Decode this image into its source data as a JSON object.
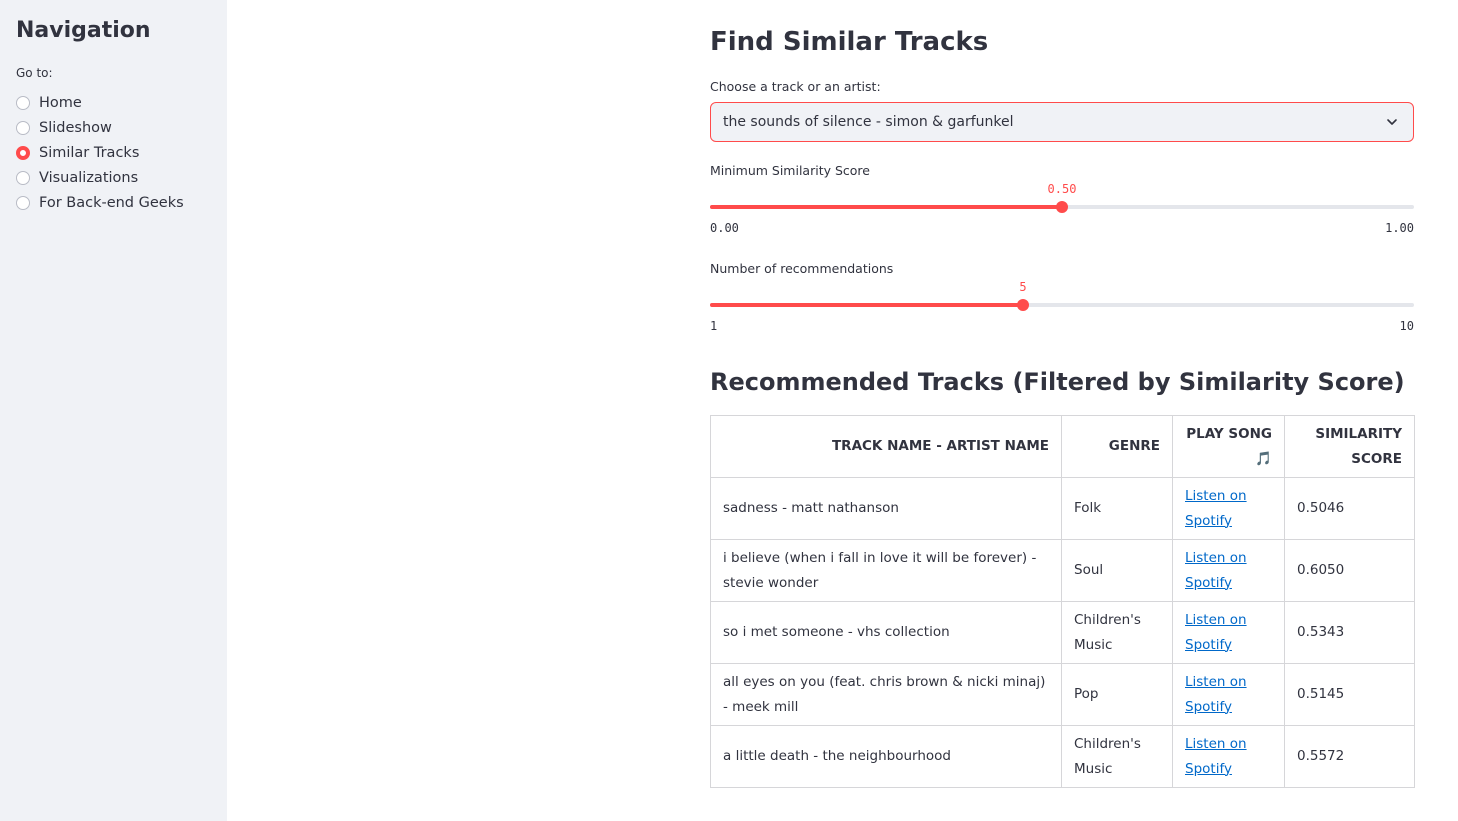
{
  "sidebar": {
    "title": "Navigation",
    "goto_label": "Go to:",
    "items": [
      {
        "label": "Home",
        "selected": false
      },
      {
        "label": "Slideshow",
        "selected": false
      },
      {
        "label": "Similar Tracks",
        "selected": true
      },
      {
        "label": "Visualizations",
        "selected": false
      },
      {
        "label": "For Back-end Geeks",
        "selected": false
      }
    ]
  },
  "main": {
    "title": "Find Similar Tracks",
    "select_label": "Choose a track or an artist:",
    "select_value": "the sounds of silence - simon & garfunkel",
    "similarity_slider": {
      "label": "Minimum Similarity Score",
      "value": "0.50",
      "fraction": 0.5,
      "min": "0.00",
      "max": "1.00"
    },
    "count_slider": {
      "label": "Number of recommendations",
      "value": "5",
      "fraction": 0.4444,
      "min": "1",
      "max": "10"
    },
    "table_title": "Recommended Tracks (Filtered by Similarity Score)",
    "table": {
      "headers": [
        "TRACK NAME - ARTIST NAME",
        "GENRE",
        "PLAY SONG 🎵",
        "SIMILARITY SCORE"
      ],
      "rows": [
        {
          "track": "sadness - matt nathanson",
          "genre": "Folk",
          "link": "Listen on Spotify",
          "score": "0.5046"
        },
        {
          "track": "i believe (when i fall in love it will be forever) - stevie wonder",
          "genre": "Soul",
          "link": "Listen on Spotify",
          "score": "0.6050"
        },
        {
          "track": "so i met someone - vhs collection",
          "genre": "Children's Music",
          "link": "Listen on Spotify",
          "score": "0.5343"
        },
        {
          "track": "all eyes on you (feat. chris brown & nicki minaj) - meek mill",
          "genre": "Pop",
          "link": "Listen on Spotify",
          "score": "0.5145"
        },
        {
          "track": "a little death - the neighbourhood",
          "genre": "Children's Music",
          "link": "Listen on Spotify",
          "score": "0.5572"
        }
      ]
    }
  },
  "colors": {
    "accent": "#ff4b4b",
    "sidebar_bg": "#f0f2f6",
    "link": "#0068c9"
  }
}
